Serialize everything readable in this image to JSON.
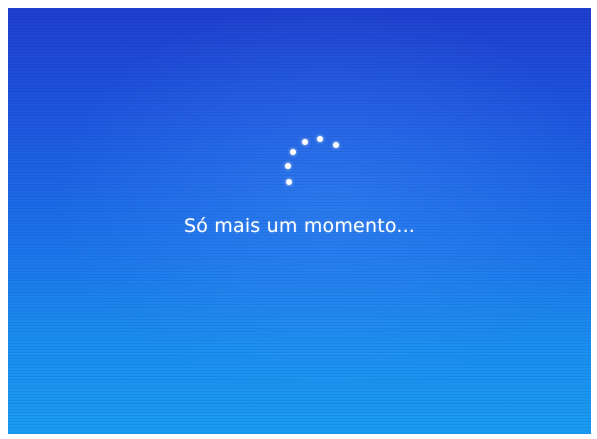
{
  "setup_screen": {
    "message": "Só mais um momento...",
    "spinner_icon": "loading-dots-spinner-icon",
    "background_color": "#1e5fe2",
    "text_color": "#ffffff"
  }
}
